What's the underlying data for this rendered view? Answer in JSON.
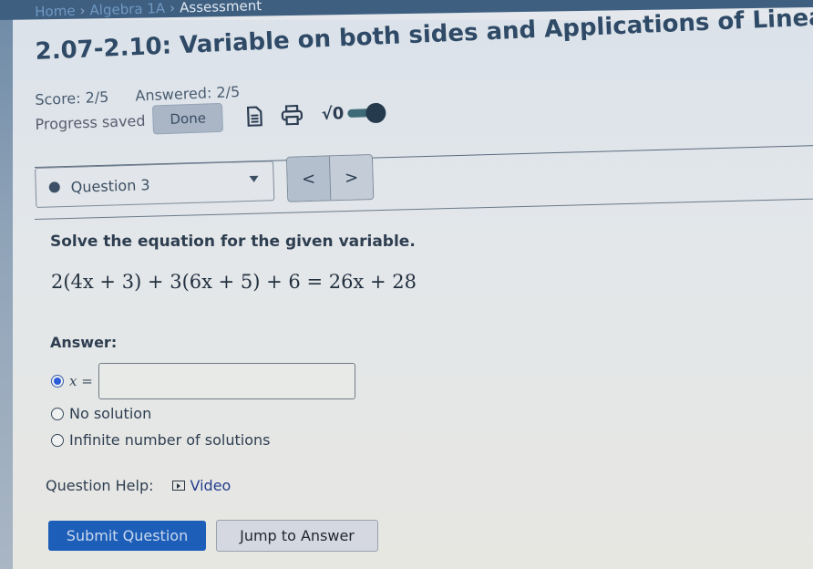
{
  "breadcrumb": {
    "items": [
      {
        "label": "Home",
        "type": "link"
      },
      {
        "label": "Algebra 1A",
        "type": "link"
      },
      {
        "label": "Assessment",
        "type": "current"
      }
    ],
    "separator": "›"
  },
  "assignment": {
    "title": "2.07-2.10: Variable on both sides and Applications of Linea",
    "score": "Score: 2/5",
    "answered": "Answered: 2/5",
    "progress_status": "Progress saved",
    "done_label": "Done"
  },
  "toolbar": {
    "icons": [
      "document-icon",
      "print-icon",
      "math-symbol-icon",
      "toggle-switch"
    ],
    "sqrt_label": "√0"
  },
  "question_nav": {
    "selected": "Question 3",
    "prev_label": "<",
    "next_label": ">"
  },
  "question": {
    "prompt": "Solve the equation for the given variable.",
    "equation": "2(4x + 3) + 3(6x + 5) + 6 = 26x + 28",
    "answer_label": "Answer:",
    "options": [
      {
        "label": "x =",
        "type": "input",
        "selected": true,
        "value": ""
      },
      {
        "label": "No solution",
        "type": "radio",
        "selected": false
      },
      {
        "label": "Infinite number of solutions",
        "type": "radio",
        "selected": false
      }
    ]
  },
  "help": {
    "label": "Question Help:",
    "video_label": "Video"
  },
  "actions": {
    "submit_label": "Submit Question",
    "jump_label": "Jump to Answer"
  },
  "colors": {
    "header_bar": "#3f5f80",
    "title": "#2f4a66",
    "submit_bg": "#1d5eb8",
    "radio_selected": "#2a5cd8",
    "video_link": "#233c8c"
  }
}
